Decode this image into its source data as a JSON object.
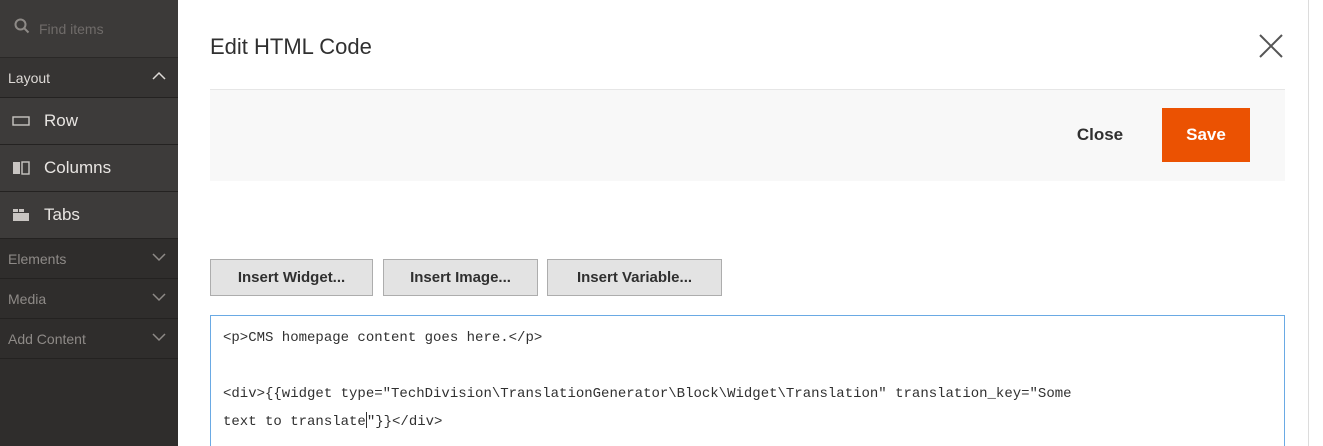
{
  "sidebar": {
    "search_placeholder": "Find items",
    "sections": [
      {
        "label": "Layout",
        "state": "expanded"
      },
      {
        "label": "Elements",
        "state": "collapsed"
      },
      {
        "label": "Media",
        "state": "collapsed"
      },
      {
        "label": "Add Content",
        "state": "collapsed"
      }
    ],
    "layout_items": [
      {
        "label": "Row",
        "icon": "row-icon"
      },
      {
        "label": "Columns",
        "icon": "columns-icon"
      },
      {
        "label": "Tabs",
        "icon": "tabs-icon"
      }
    ]
  },
  "modal": {
    "title": "Edit HTML Code",
    "close_label": "Close",
    "save_label": "Save",
    "accent_color": "#eb5202",
    "insert_buttons": [
      "Insert Widget...",
      "Insert Image...",
      "Insert Variable..."
    ]
  },
  "editor": {
    "line1": "<p>CMS homepage content goes here.</p>",
    "line2": "<div>{{widget type=\"TechDivision\\TranslationGenerator\\Block\\Widget\\Translation\" translation_key=\"Some",
    "line3_before_caret": "text to translate",
    "line3_after_caret": "\"}}</div>"
  }
}
